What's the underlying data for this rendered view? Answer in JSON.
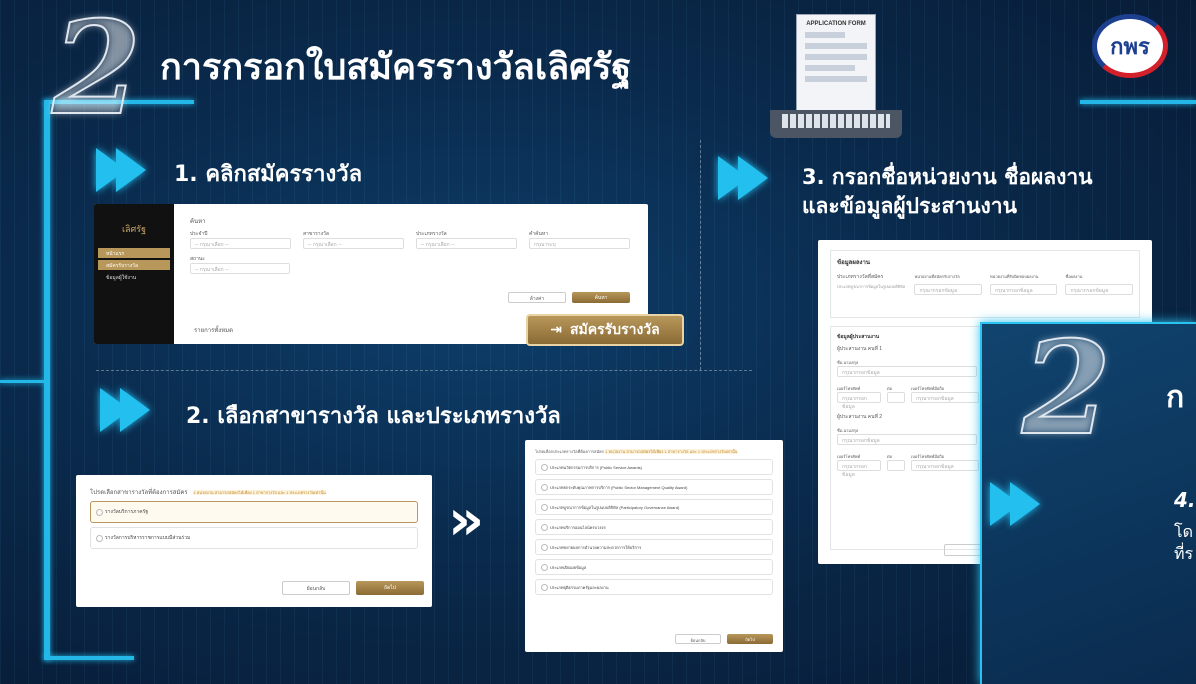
{
  "header": {
    "step_number": "2",
    "title": "การกรอกใบสมัครรางวัลเลิศรัฐ",
    "form_label": "APPLICATION FORM",
    "logo_text": "กพร"
  },
  "step1": {
    "title": "1. คลิกสมัครรางวัล",
    "brand": "เลิศรัฐ",
    "menu": [
      "หน้าแรก",
      "สมัครรับรางวัล",
      "ข้อมูลผู้ใช้งาน"
    ],
    "search_label": "ค้นหา",
    "fields": [
      {
        "label": "ประจำปี",
        "placeholder": "-- กรุณาเลือก --"
      },
      {
        "label": "สาขารางวัล",
        "placeholder": "-- กรุณาเลือก --"
      },
      {
        "label": "ประเภทรางวัล",
        "placeholder": "-- กรุณาเลือก --"
      },
      {
        "label": "คำค้นหา",
        "placeholder": "กรุณาระบุ"
      }
    ],
    "status_label": "สถานะ",
    "status_placeholder": "-- กรุณาเลือก --",
    "clear_label": "ล้างค่า",
    "search_button": "ค้นหา",
    "list_label": "รายการทั้งหมด",
    "apply_button": "สมัครรับรางวัล"
  },
  "step2": {
    "title": "2. เลือกสาขารางวัล และประเภทรางวัล",
    "prompt": "โปรดเลือกสาขารางวัลที่ต้องการสมัคร",
    "note": "1 หน่วยงาน สามารถสมัครได้เพียง 1 สาขารางวัล และ 1 ประเภทรางวัลเท่านั้น",
    "branches": [
      "รางวัลบริการภาครัฐ",
      "รางวัลการบริหารราชการแบบมีส่วนร่วม"
    ],
    "back_label": "ย้อนกลับ",
    "next_label": "ถัดไป",
    "type_prompt": "โปรดเลือกประเภทรางวัลที่ต้องการสมัคร",
    "type_note": "1 หน่วยงาน สามารถสมัครได้เพียง 1 สาขารางวัล และ 1 ประเภทรางวัลเท่านั้น",
    "types": [
      "ประเภทนวัตกรรมการบริการ (Public Service Awards)",
      "ประเภทยกระดับคุณภาพการบริการ (Public Sector Management Quality Award)",
      "ประเภทบูรณาการข้อมูลในรูปแบบดิจิทัล (Participatory Governance Award)",
      "ประเภทบริการออนไลน์ครบวงจร",
      "ประเภทขยายผลการอำนวยความสะดวกการให้บริการ",
      "ประเภทเปิดเผยข้อมูล",
      "ประเภทยุติธรรมภาครัฐและผลงาน"
    ]
  },
  "step3": {
    "title_line1": "3. กรอกชื่อหน่วยงาน ชื่อผลงาน",
    "title_line2": "และข้อมูลผู้ประสานงาน",
    "section_award": "ข้อมูลผลงาน",
    "award_type_label": "ประเภทรางวัลที่สมัคร",
    "award_type_value": "ประเภทบูรณาการข้อมูลในรูปแบบดิจิทัล",
    "agency_label": "หน่วยงานที่สมัครรับรางวัล",
    "sub_agency_label": "หน่วยงานที่รับผิดชอบผลงาน",
    "work_label": "ชื่อผลงาน",
    "input_placeholder": "กรุณากรอกข้อมูล",
    "section_coord": "ข้อมูลผู้ประสานงาน",
    "coordinators": [
      "ผู้ประสานงาน คนที่ 1",
      "ผู้ประสานงาน คนที่ 2"
    ],
    "name_label": "ชื่อ-นามสกุล",
    "phone_label": "เบอร์โทรศัพท์",
    "ext_label": "ต่อ",
    "mobile_label": "เบอร์โทรศัพท์มือถือ"
  },
  "step4": {
    "title_partial": "ก",
    "item_partial": "4.",
    "line1_partial": "โด",
    "line2_partial": "ที่ร"
  },
  "colors": {
    "accent_cyan": "#23c0ef",
    "gold": "#a8884d",
    "background": "#0a2a4c"
  }
}
